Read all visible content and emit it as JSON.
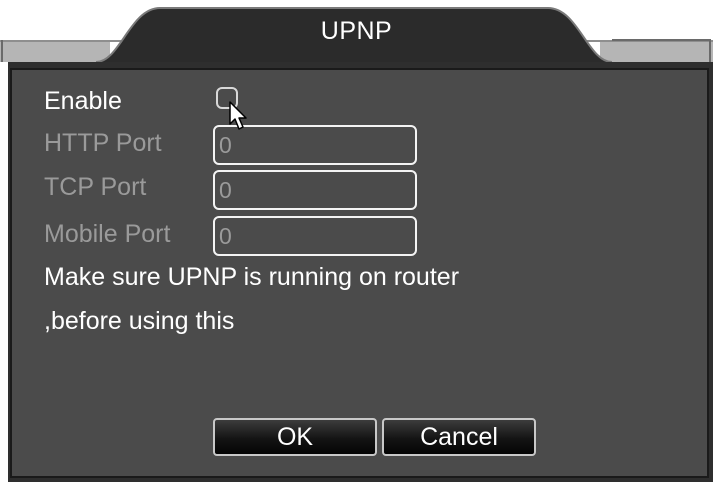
{
  "dialog": {
    "title": "UPNP"
  },
  "form": {
    "enable_label": "Enable",
    "enable_checked": false,
    "http_port_label": "HTTP Port",
    "http_port_value": "0",
    "tcp_port_label": "TCP Port",
    "tcp_port_value": "0",
    "mobile_port_label": "Mobile Port",
    "mobile_port_value": "0"
  },
  "notice": {
    "line1": "Make sure UPNP is running on router",
    "line2": ",before using this"
  },
  "buttons": {
    "ok_label": "OK",
    "cancel_label": "Cancel"
  },
  "colors": {
    "panel_bg": "#4b4b4b",
    "title_tab": "#2b2b2b",
    "title_strip": "#b5b5b5",
    "text_active": "#ffffff",
    "text_disabled": "#9a9a9a"
  }
}
